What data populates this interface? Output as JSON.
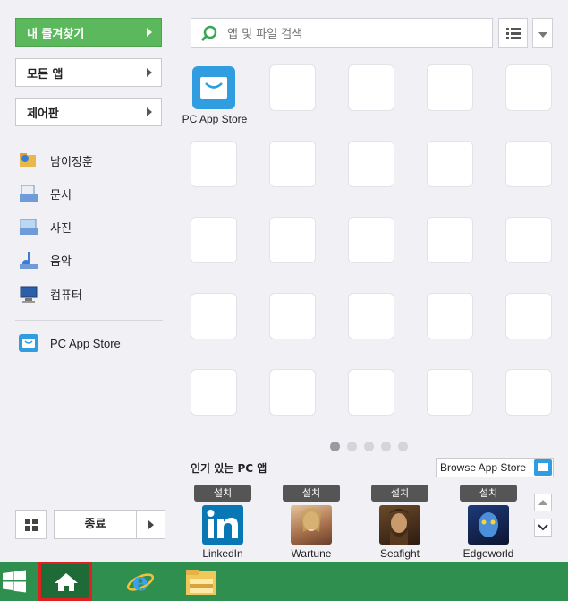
{
  "left": {
    "favorites_label": "내 즐겨찾기",
    "all_apps_label": "모든 앱",
    "control_panel_label": "제어판",
    "places": [
      "남이정훈",
      "문서",
      "사진",
      "음악",
      "컴퓨터"
    ],
    "pinned_label": "PC App Store",
    "exit_label": "종료"
  },
  "search": {
    "placeholder": "앱 및 파일 검색"
  },
  "grid": {
    "first_app_label": "PC App Store",
    "page_count": 5,
    "current_page": 1
  },
  "popular": {
    "title": "인기 있는 PC 앱",
    "browse_label": "Browse App Store",
    "install_label": "설치",
    "apps": [
      "LinkedIn",
      "Wartune",
      "Seafight",
      "Edgeworld"
    ]
  },
  "colors": {
    "accent": "#5cb85c",
    "taskbar": "#2f8f4f",
    "highlight": "#e02020"
  }
}
